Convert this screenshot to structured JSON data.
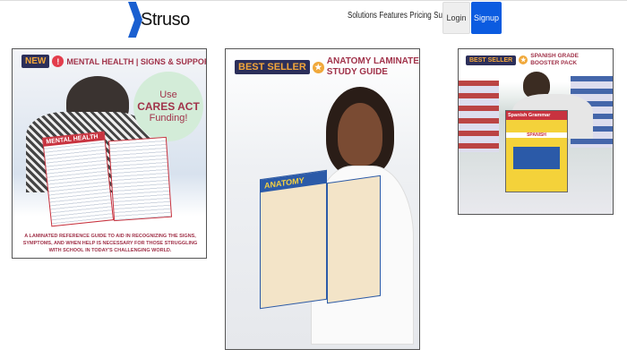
{
  "header": {
    "logo_text": "Struso",
    "nav": [
      "Solutions",
      "Features",
      "Pricing",
      "Support"
    ],
    "login_label": "Login",
    "signup_label": "Signup"
  },
  "products": [
    {
      "badge": "NEW",
      "badge_icon": "!",
      "title": "MENTAL HEALTH | SIGNS & SUPPORT",
      "promo": [
        "Use",
        "CARES ACT",
        "Funding!"
      ],
      "chart_title": "MENTAL HEALTH",
      "description": "A LAMINATED REFERENCE GUIDE TO AID IN RECOGNIZING THE SIGNS, SYMPTOMS, AND WHEN HELP IS NECESSARY FOR THOSE STRUGGLING WITH SCHOOL IN TODAY'S CHALLENGING WORLD."
    },
    {
      "badge": "BEST SELLER",
      "badge_icon": "★",
      "title_line1": "ANATOMY LAMINATED",
      "title_line2": "STUDY GUIDE",
      "chart_title": "ANATOMY"
    },
    {
      "badge": "BEST SELLER",
      "badge_icon": "★",
      "title_line1": "SPANISH GRADE",
      "title_line2": "BOOSTER PACK",
      "chart_title": "Spanish Grammar",
      "chart_sub": "SPANISH"
    }
  ]
}
